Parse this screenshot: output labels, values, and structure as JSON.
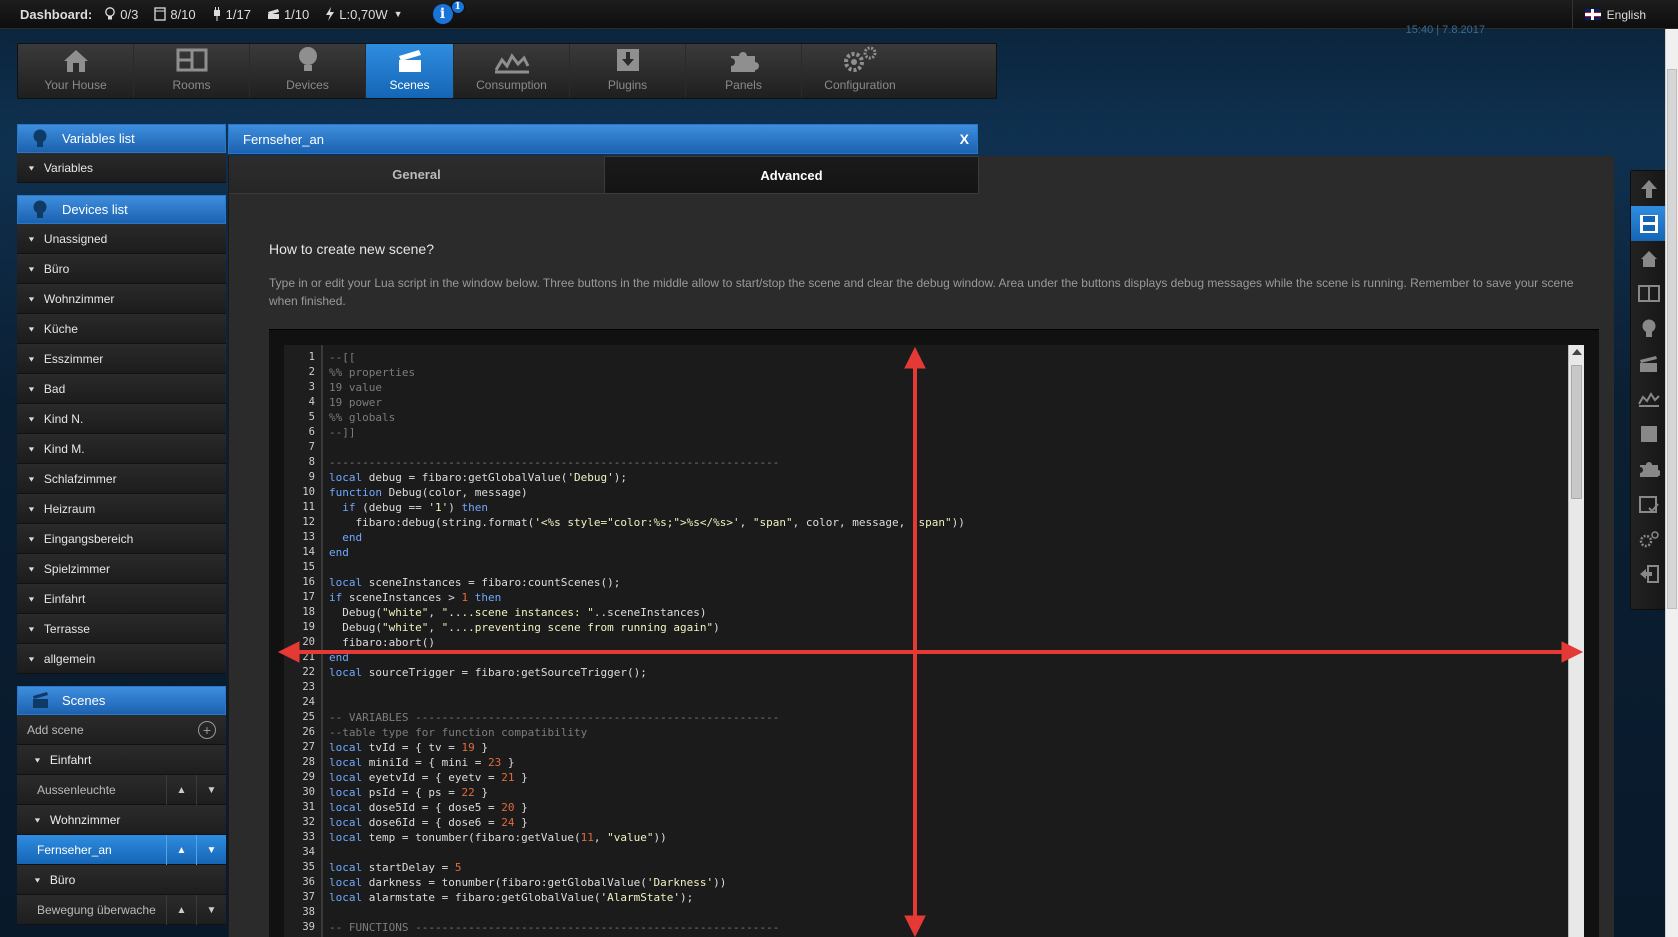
{
  "topbar": {
    "dashboard_label": "Dashboard:",
    "stats": [
      {
        "icon": "lightbulb-icon",
        "value": "0/3"
      },
      {
        "icon": "blind-icon",
        "value": "8/10"
      },
      {
        "icon": "plug-icon",
        "value": "1/17"
      },
      {
        "icon": "scene-icon",
        "value": "1/10"
      },
      {
        "icon": "lightning-icon",
        "value": "L:0,70W"
      }
    ],
    "info_count": "1",
    "clock": "15:40 | 7.8.2017",
    "language": "English"
  },
  "nav": {
    "items": [
      {
        "label": "Your House",
        "icon": "house-icon"
      },
      {
        "label": "Rooms",
        "icon": "rooms-icon"
      },
      {
        "label": "Devices",
        "icon": "bulb-icon"
      },
      {
        "label": "Scenes",
        "icon": "clapper-icon",
        "active": true
      },
      {
        "label": "Consumption",
        "icon": "chart-icon"
      },
      {
        "label": "Plugins",
        "icon": "box-icon"
      },
      {
        "label": "Panels",
        "icon": "puzzle-icon"
      },
      {
        "label": "Configuration",
        "icon": "gears-icon"
      }
    ]
  },
  "sidebar": {
    "variables": {
      "title": "Variables list",
      "items": [
        "Variables"
      ]
    },
    "devices": {
      "title": "Devices list",
      "items": [
        "Unassigned",
        "Büro",
        "Wohnzimmer",
        "Küche",
        "Esszimmer",
        "Bad",
        "Kind N.",
        "Kind M.",
        "Schlafzimmer",
        "Heizraum",
        "Eingangsbereich",
        "Spielzimmer",
        "Einfahrt",
        "Terrasse",
        "allgemein"
      ]
    },
    "scenes": {
      "title": "Scenes",
      "add_label": "Add scene",
      "group1": "Einfahrt",
      "scene1": "Aussenleuchte",
      "group2": "Wohnzimmer",
      "scene2": "Fernseher_an",
      "group3": "Büro",
      "scene3": "Bewegung überwache"
    }
  },
  "scene": {
    "name": "Fernseher_an",
    "close_label": "X",
    "tabs": {
      "general": "General",
      "advanced": "Advanced"
    },
    "howto_title": "How to create new scene?",
    "howto_text": "Type in or edit your Lua script in the window below. Three buttons in the middle allow to start/stop the scene and clear the debug window. Area under the buttons displays debug messages while the scene is running. Remember to save your scene when finished."
  },
  "code": {
    "lines": [
      "--[[",
      "%% properties",
      "19 value",
      "19 power",
      "%% globals",
      "--]]",
      "",
      "--------------------------------------------------------------------",
      "local debug = fibaro:getGlobalValue('Debug');",
      "function Debug(color, message)",
      "  if (debug == '1') then",
      "    fibaro:debug(string.format('<%s style=\"color:%s;\">%s</%s>', \"span\", color, message, \"span\"))",
      "  end",
      "end",
      "",
      "local sceneInstances = fibaro:countScenes();",
      "if sceneInstances > 1 then",
      "  Debug(\"white\", \"....scene instances: \"..sceneInstances)",
      "  Debug(\"white\", \"....preventing scene from running again\")",
      "  fibaro:abort()",
      "end",
      "local sourceTrigger = fibaro:getSourceTrigger();",
      "",
      "",
      "-- VARIABLES -------------------------------------------------------",
      "--table type for function compatibility",
      "local tvId = { tv = 19 }",
      "local miniId = { mini = 23 }",
      "local eyetvId = { eyetv = 21 }",
      "local psId = { ps = 22 }",
      "local dose5Id = { dose5 = 20 }",
      "local dose6Id = { dose6 = 24 }",
      "local temp = tonumber(fibaro:getValue(11, \"value\"))",
      "",
      "local startDelay = 5",
      "local darkness = tonumber(fibaro:getGlobalValue('Darkness'))",
      "local alarmstate = fibaro:getGlobalValue('AlarmState');",
      "",
      "-- FUNCTIONS -------------------------------------------------------"
    ]
  },
  "righttool": {
    "icons": [
      "arrow-up-icon",
      "save-icon",
      "house-icon",
      "rooms-icon",
      "bulb-icon",
      "clapper-icon",
      "chart-icon",
      "box-icon",
      "puzzle-icon",
      "calendar-icon",
      "gears-icon",
      "exit-icon"
    ],
    "active_index": 1
  },
  "colors": {
    "accent": "#1f6fc2",
    "overlay_arrow": "#e53935"
  }
}
